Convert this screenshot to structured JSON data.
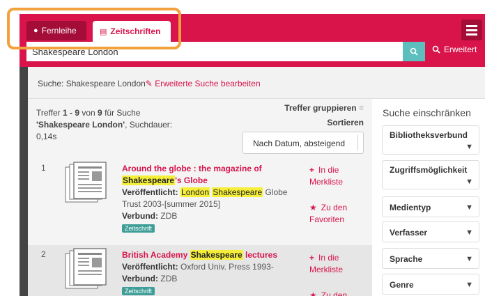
{
  "tabs": {
    "fernleihe": "Fernleihe",
    "zeitschriften": "Zeitschriften"
  },
  "search": {
    "value": "Shakespeare London",
    "advanced": "Erweitert"
  },
  "breadcrumb": {
    "prefix": "Suche: Shakespeare London",
    "edit_link": "Erweiterte Suche bearbeiten"
  },
  "results_header": {
    "line1_a": "Treffer ",
    "range": "1 - 9",
    "line1_b": " von ",
    "total": "9",
    "line1_c": " für Suche",
    "query": "'Shakespeare London'",
    "duration": ", Suchdauer: 0,14s",
    "group_label": "Treffer gruppieren",
    "sort_label": "Sortieren",
    "sort_value": "Nach Datum, absteigend"
  },
  "results": [
    {
      "number": "1",
      "title_a": "Around the globe : the magazine of ",
      "title_hl": "Shakespeare",
      "title_b": "'s Globe",
      "pub_label": "Veröffentlicht:",
      "pub_hl1": "London",
      "pub_hl2": "Shakespeare",
      "pub_rest": " Globe Trust 2003-[summer 2015]",
      "verbund_label": "Verbund:",
      "verbund": "ZDB",
      "badge": "Zeitschrift",
      "action1": "In die Merkliste",
      "action2": "Zu den Favoriten"
    },
    {
      "number": "2",
      "title_a": "British Academy ",
      "title_hl": "Shakespeare",
      "title_b": " lectures",
      "pub_label": "Veröffentlicht:",
      "pub_rest": " Oxford Univ. Press 1993-",
      "verbund_label": "Verbund:",
      "verbund": "ZDB",
      "badge": "Zeitschrift",
      "action1": "In die Merkliste",
      "action2": "Zu den"
    }
  ],
  "sidebar": {
    "title": "Suche einschränken",
    "facets": [
      "Bibliotheksverbund",
      "Zugriffsmöglichkeit",
      "Medientyp",
      "Verfasser",
      "Sprache",
      "Genre"
    ]
  },
  "colors": {
    "brand": "#d8144b",
    "accent": "#5cbfbd",
    "highlight": "#f5ef3a",
    "callout": "#f2a13c"
  }
}
